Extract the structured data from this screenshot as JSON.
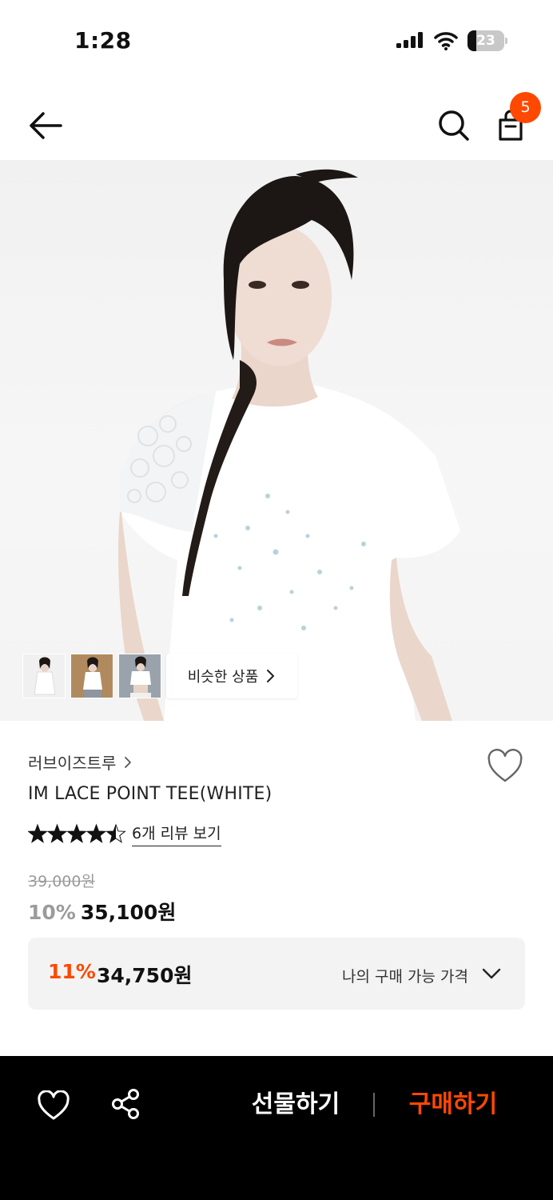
{
  "status_bar": {
    "time": "1:28",
    "battery_level": "23"
  },
  "header": {
    "cart_count": "5"
  },
  "gallery": {
    "thumbnails": [
      "thumb-1",
      "thumb-2",
      "thumb-3"
    ],
    "similar_label": "비슷한 상품"
  },
  "product": {
    "brand": "러브이즈트루",
    "name": "IM LACE POINT TEE(WHITE)",
    "rating": 4.5,
    "review_link": "6개 리뷰 보기",
    "original_price": "39,000원",
    "discount_rate": "10%",
    "sale_price": "35,100원"
  },
  "my_price": {
    "rate": "11%",
    "price": "34,750원",
    "label": "나의 구매 가능 가격"
  },
  "bottom_bar": {
    "gift_label": "선물하기",
    "buy_label": "구매하기"
  },
  "colors": {
    "accent": "#ff4800",
    "bar_bg": "#000000"
  }
}
